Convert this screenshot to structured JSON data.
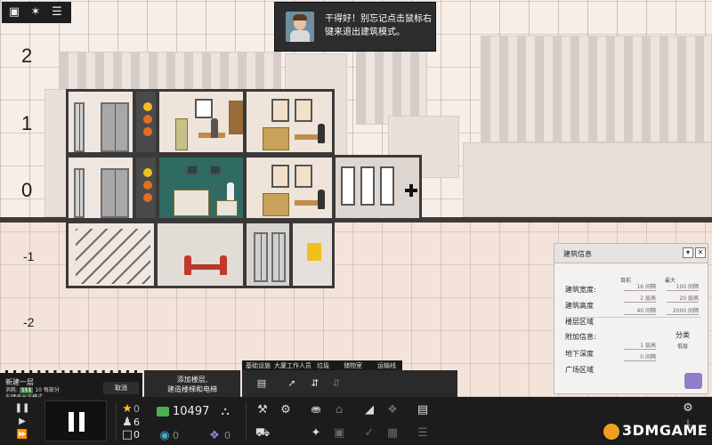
{
  "toolbar_top": {
    "icons": [
      "layers-icon",
      "sparkle-icon",
      "list-icon"
    ]
  },
  "tooltip": {
    "text": "干得好！别忘记点击鼠标右键来退出建筑模式。"
  },
  "floors": {
    "labels": [
      "2",
      "1",
      "0",
      "-1",
      "-2"
    ]
  },
  "info_panel": {
    "title": "建筑信息",
    "col_current": "目前",
    "col_max": "最大",
    "width_label": "建筑宽度:",
    "width_current": "16 间隔",
    "width_max": "100 间隔",
    "height_label": "建筑高度",
    "height_current": "2 层高",
    "height_max": "20 层高",
    "height_current2": "40 间隔",
    "height_max2": "2000 间隔",
    "floor_zone_label": "楼层区域",
    "extra_label": "附加信息:",
    "category_label": "分类",
    "category_value": "低层",
    "basement_label": "地下深度",
    "basement_current": "1 层高",
    "basement_current2": "0 间隔",
    "plaza_label": "广场区域"
  },
  "drawer": {
    "title": "新建一层",
    "cost_prefix": "消耗:",
    "cost_badge": "$$$",
    "cost_rest": "10 每部分",
    "hint": "右键退出该模式",
    "cancel": "取消"
  },
  "add_floor": {
    "line1": "添加楼层,",
    "line2": "建造楼梯和电梯"
  },
  "category_tabs": [
    "基础设施",
    "大厦工作人员",
    "垃圾",
    "储物室",
    "运输线"
  ],
  "hud": {
    "money": "10497",
    "stars": "0",
    "people": "6",
    "tenants": "0",
    "rating_a": "0",
    "rating_b": "0"
  },
  "colors": {
    "hud_bg": "#1c1c1c",
    "money_badge": "#4caf50",
    "panel_bg": "#f4f2f1"
  },
  "watermark": "3DMGAME"
}
